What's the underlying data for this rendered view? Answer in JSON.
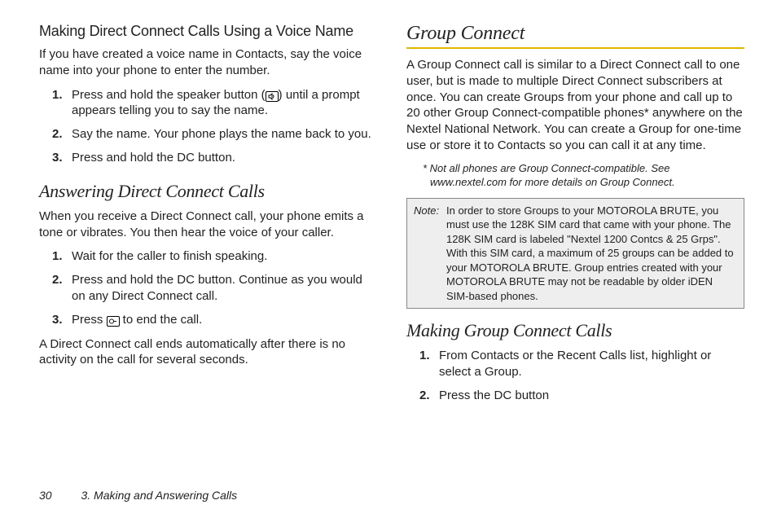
{
  "left": {
    "h_voice": "Making Direct Connect Calls Using a Voice Name",
    "p_voice": "If you have created a voice name in Contacts, say the voice name into your phone to enter the number.",
    "voice_steps": [
      {
        "pre": "Press and hold the speaker button (",
        "post": ") until a prompt appears telling you to say the name.",
        "icon": "speaker"
      },
      {
        "text": "Say the name. Your phone plays the name back to you."
      },
      {
        "text": "Press and hold the DC button."
      }
    ],
    "h_answer": "Answering Direct Connect Calls",
    "p_answer": "When you receive a Direct Connect call, your phone emits a tone or vibrates. You then hear the voice of your caller.",
    "answer_steps": [
      {
        "text": "Wait for the caller to finish speaking."
      },
      {
        "text": "Press and hold the DC button. Continue as you would on any Direct Connect call."
      },
      {
        "pre": "Press ",
        "post": " to end the call.",
        "icon": "end"
      }
    ],
    "p_end": "A Direct Connect call ends automatically after there is no activity on the call for several seconds."
  },
  "right": {
    "h_group": "Group Connect",
    "p_group": "A Group Connect call is similar to a Direct Connect call to one user, but is made to multiple Direct Connect subscribers at once. You can create Groups from your phone and call up to 20 other Group Connect-compatible phones* anywhere on the Nextel National Network. You can create a Group for one-time use or store it to Contacts so you can call it at any time.",
    "footnote": "* Not all phones are Group Connect-compatible. See www.nextel.com for more details on Group Connect.",
    "note_label": "Note:",
    "note_body": "In order to store Groups to your MOTOROLA BRUTE, you must use the 128K SIM card that came with your phone. The 128K SIM card is labeled \"Nextel 1200 Contcs & 25 Grps\". With this SIM card, a maximum of 25 groups can be added to your MOTOROLA BRUTE. Group entries created with your MOTOROLA BRUTE may not be readable by older iDEN SIM-based phones.",
    "h_making": "Making Group Connect Calls",
    "making_steps": [
      {
        "text": "From Contacts or the Recent Calls list, highlight or select a Group."
      },
      {
        "text": "Press the DC button"
      }
    ]
  },
  "footer": {
    "page": "30",
    "chapter": "3. Making and Answering Calls"
  },
  "icons": {
    "speaker_glyph": "🔊",
    "end_glyph": "⦿"
  }
}
